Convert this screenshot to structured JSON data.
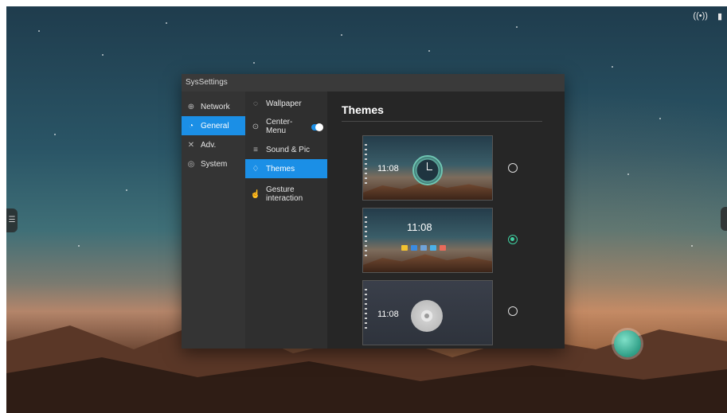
{
  "window": {
    "title": "SysSettings"
  },
  "nav": [
    {
      "label": "Network",
      "icon": "globe-icon"
    },
    {
      "label": "General",
      "icon": "palette-icon",
      "active": true
    },
    {
      "label": "Adv.",
      "icon": "tools-icon"
    },
    {
      "label": "System",
      "icon": "gear-icon"
    }
  ],
  "subnav": [
    {
      "label": "Wallpaper",
      "icon": "wallpaper-icon"
    },
    {
      "label": "Center-Menu",
      "icon": "target-icon",
      "toggle": true
    },
    {
      "label": "Sound & Pic",
      "icon": "equalizer-icon"
    },
    {
      "label": "Themes",
      "icon": "shirt-icon",
      "active": true
    },
    {
      "label": "Gesture interaction",
      "icon": "hand-icon"
    }
  ],
  "content": {
    "title": "Themes",
    "themes": [
      {
        "time": "11:08",
        "selected": false,
        "style": "ring-clock"
      },
      {
        "time": "11:08",
        "selected": true,
        "style": "app-dock"
      },
      {
        "time": "11:08",
        "selected": false,
        "style": "wheel"
      }
    ]
  },
  "colors": {
    "accent": "#1b8fe6",
    "radio_selected": "#3fcfa0"
  }
}
